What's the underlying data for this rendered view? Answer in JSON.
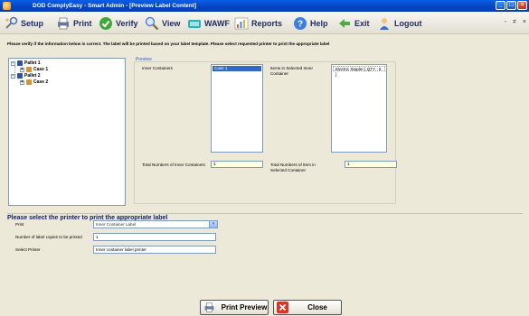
{
  "window": {
    "title": "DOD ComplyEasy - Smart Admin - [Preview Label Content]",
    "controls": [
      "_",
      "□",
      "×"
    ]
  },
  "toolbar": {
    "items": [
      {
        "label": "Setup",
        "icon": "setup-icon"
      },
      {
        "label": "Print",
        "icon": "print-icon"
      },
      {
        "label": "Verify",
        "icon": "verify-icon"
      },
      {
        "label": "View",
        "icon": "view-icon"
      },
      {
        "label": "WAWF",
        "icon": "wawf-icon"
      },
      {
        "label": "Reports",
        "icon": "reports-icon"
      },
      {
        "label": "Help",
        "icon": "help-icon"
      },
      {
        "label": "Exit",
        "icon": "exit-icon"
      },
      {
        "label": "Logout",
        "icon": "logout-icon"
      }
    ],
    "mdi_controls": [
      "-",
      "≠",
      "×"
    ]
  },
  "instruction": "Please verify if the information below is correct.  The label will be printed based on your label template.  Please select requested printer to print the appropriate label",
  "tree": {
    "nodes": [
      {
        "label": "Pallet 1",
        "level": 0
      },
      {
        "label": "Case 1",
        "level": 1
      },
      {
        "label": "Pallet 2",
        "level": 0
      },
      {
        "label": "Case 2",
        "level": 1
      }
    ]
  },
  "preview": {
    "title": "Preview",
    "inner_containers_label": "Inner Containers",
    "inner_containers": [
      "Case 1"
    ],
    "items_label": "Items in Selected Inner Container",
    "items": [
      "Electric Stapler  [ QTY : 5 ]"
    ],
    "total_inner_label": "Total Numbers of Inner Containers",
    "total_inner_value": "1",
    "total_items_label": "Total Numbers of Item in Selected Container",
    "total_items_value": "1"
  },
  "printer": {
    "title": "Please select the printer to print the appropriate label",
    "print_label": "Print",
    "print_value": "Inner Container Label",
    "copies_label": "Number of label copies to be printed",
    "copies_value": "1",
    "printer_label": "Select Printer",
    "printer_value": "Inner container label printer"
  },
  "buttons": {
    "preview": "Print Preview",
    "close": "Close"
  },
  "colors": {
    "titlebar": "#0A5FE6",
    "toolbar_text": "#1F2A5C",
    "section_title": "#0F1D6A",
    "selection": "#316AC5",
    "window_bg": "#ECE9D8"
  }
}
